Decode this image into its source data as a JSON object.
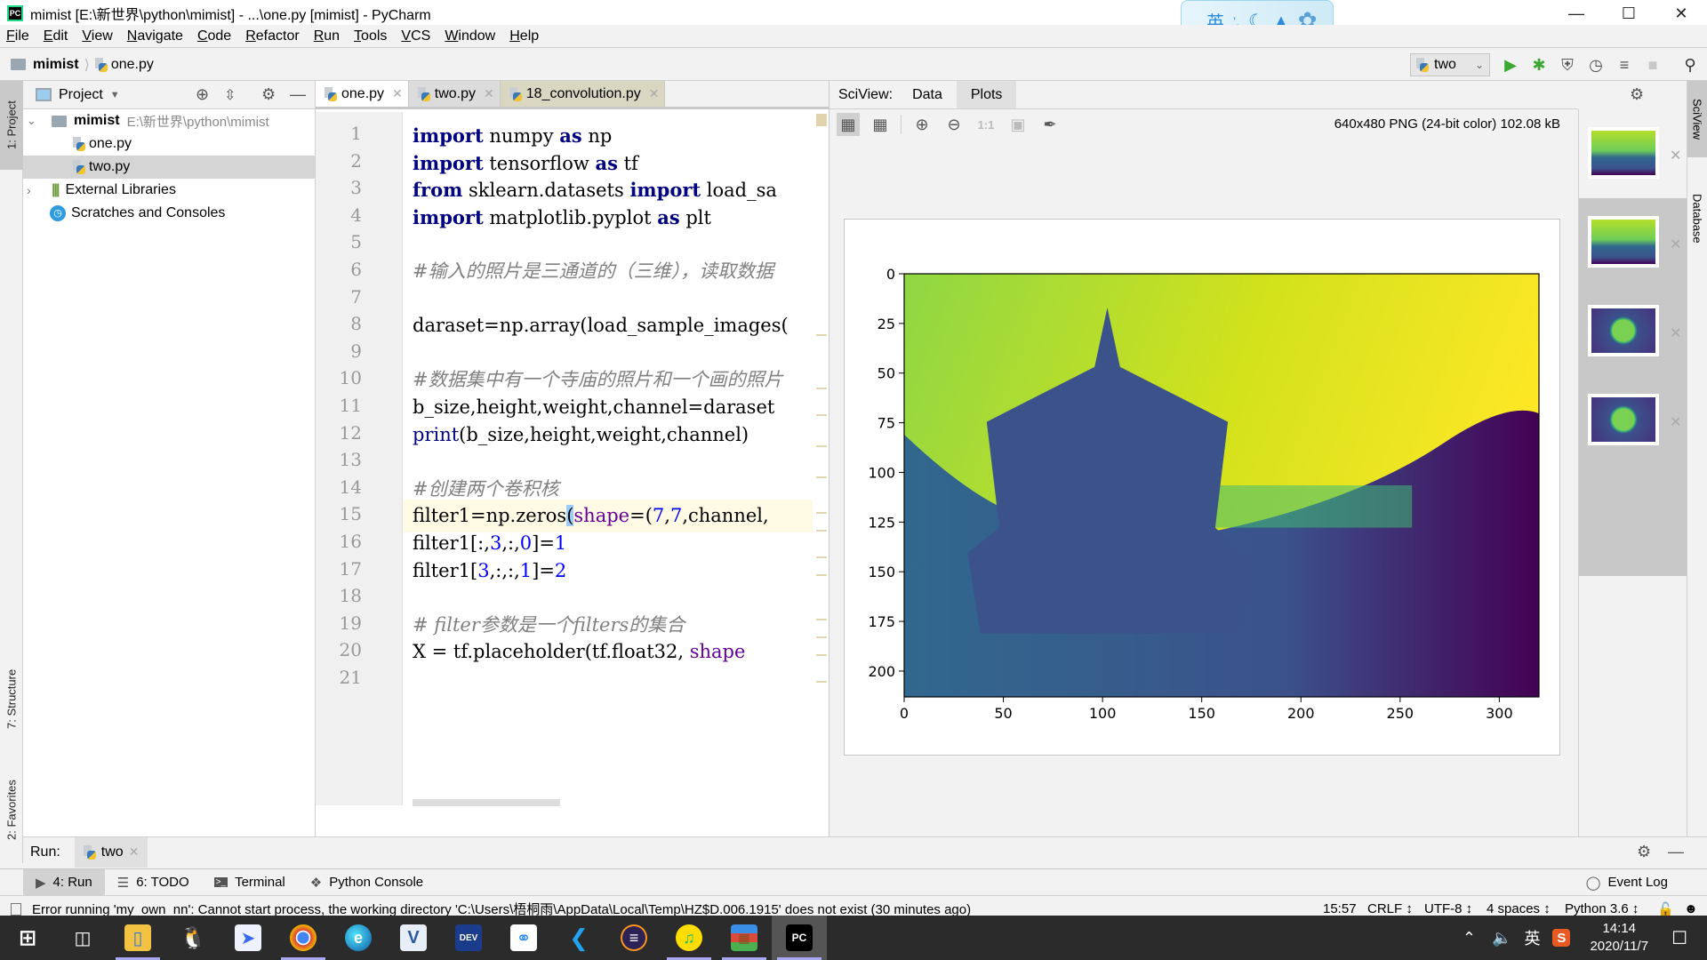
{
  "window": {
    "title": "mimist [E:\\新世界\\python\\mimist] - ...\\one.py [mimist] - PyCharm",
    "app_icon": "pycharm-icon",
    "controls": [
      "minimize",
      "maximize",
      "close"
    ]
  },
  "ime_bar": {
    "lang": "英",
    "icons": [
      "punctuation-icon",
      "moon-icon",
      "shirt-icon",
      "flower-icon"
    ]
  },
  "menu": [
    "File",
    "Edit",
    "View",
    "Navigate",
    "Code",
    "Refactor",
    "Run",
    "Tools",
    "VCS",
    "Window",
    "Help"
  ],
  "breadcrumb": {
    "project": "mimist",
    "file": "one.py"
  },
  "run_config": {
    "name": "two"
  },
  "toolbar_icons": [
    "run-icon",
    "debug-icon",
    "coverage-icon",
    "profile-icon",
    "concurrency-icon",
    "stop-icon",
    "search-icon"
  ],
  "left_stripe": {
    "project": "1: Project",
    "structure": "7: Structure",
    "favorites": "2: Favorites"
  },
  "project_panel": {
    "title": "Project",
    "tree": [
      {
        "label": "mimist",
        "path": "E:\\新世界\\python\\mimist",
        "level": 0,
        "type": "folder",
        "expanded": true
      },
      {
        "label": "one.py",
        "level": 1,
        "type": "py"
      },
      {
        "label": "two.py",
        "level": 1,
        "type": "py",
        "selected": true
      },
      {
        "label": "External Libraries",
        "level": 0,
        "type": "libs",
        "expanded": false
      },
      {
        "label": "Scratches and Consoles",
        "level": 0,
        "type": "scratch"
      }
    ]
  },
  "editor": {
    "tabs": [
      {
        "label": "one.py",
        "active": true
      },
      {
        "label": "two.py",
        "active": false
      },
      {
        "label": "18_convolution.py",
        "active": false
      }
    ],
    "current_line": 15,
    "lines": [
      {
        "n": "1",
        "text": "import numpy as np"
      },
      {
        "n": "2",
        "text": "import tensorflow as tf"
      },
      {
        "n": "3",
        "text": "from sklearn.datasets import load_sa"
      },
      {
        "n": "4",
        "text": "import matplotlib.pyplot as plt"
      },
      {
        "n": "5",
        "text": ""
      },
      {
        "n": "6",
        "text": "#输入的照片是三通道的（三维），读取数据"
      },
      {
        "n": "7",
        "text": ""
      },
      {
        "n": "8",
        "text": "daraset=np.array(load_sample_images("
      },
      {
        "n": "9",
        "text": ""
      },
      {
        "n": "10",
        "text": "#数据集中有一个寺庙的照片和一个画的照片"
      },
      {
        "n": "11",
        "text": "b_size,height,weight,channel=daraset"
      },
      {
        "n": "12",
        "text": "print(b_size,height,weight,channel)"
      },
      {
        "n": "13",
        "text": ""
      },
      {
        "n": "14",
        "text": "#创建两个卷积核"
      },
      {
        "n": "15",
        "text": "filter1=np.zeros(shape=(7,7,channel,"
      },
      {
        "n": "16",
        "text": "filter1[:,3,:,0]=1"
      },
      {
        "n": "17",
        "text": "filter1[3,:,:,1]=2"
      },
      {
        "n": "18",
        "text": ""
      },
      {
        "n": "19",
        "text": "# filter参数是一个filters的集合"
      },
      {
        "n": "20",
        "text": "X = tf.placeholder(tf.float32, shape"
      },
      {
        "n": "21",
        "text": ""
      }
    ]
  },
  "sciview": {
    "label": "SciView:",
    "tabs": [
      {
        "label": "Data",
        "active": false
      },
      {
        "label": "Plots",
        "active": true
      }
    ],
    "tools": [
      "chessboard-icon",
      "grid-icon",
      "zoom-in-icon",
      "zoom-out-icon",
      "actual-size-icon",
      "fit-icon",
      "color-picker-icon"
    ],
    "actual_size_label": "1:1",
    "image_info": "640x480 PNG (24-bit color) 102.08 kB",
    "thumbnails": [
      {
        "subject": "temple",
        "selected": true
      },
      {
        "subject": "temple",
        "selected": false
      },
      {
        "subject": "flower",
        "selected": false
      },
      {
        "subject": "flower",
        "selected": false
      }
    ]
  },
  "chart_data": {
    "type": "heatmap",
    "title": "",
    "description": "imshow of temple sample image (single channel, viridis colormap)",
    "colormap": "viridis",
    "x_ticks": [
      "0",
      "50",
      "100",
      "150",
      "200",
      "250",
      "300"
    ],
    "y_ticks": [
      "0",
      "25",
      "50",
      "75",
      "100",
      "125",
      "150",
      "175",
      "200"
    ],
    "xlim": [
      0,
      320
    ],
    "ylim": [
      213,
      0
    ]
  },
  "right_stripe": {
    "sciview": "SciView",
    "database": "Database"
  },
  "run_panel": {
    "label": "Run:",
    "tab": "two"
  },
  "bottom_tabs": [
    {
      "label": "4: Run",
      "icon": "run-icon",
      "active": true
    },
    {
      "label": "6: TODO",
      "icon": "list-icon",
      "active": false
    },
    {
      "label": "Terminal",
      "icon": "terminal-icon",
      "active": false
    },
    {
      "label": "Python Console",
      "icon": "python-console-icon",
      "active": false
    }
  ],
  "event_log": "Event Log",
  "status": {
    "message": "Error running 'my_own_nn': Cannot start process, the working directory 'C:\\Users\\梧桐雨\\AppData\\Local\\Temp\\HZ$D.006.1915' does not exist (30 minutes ago)",
    "position": "15:57",
    "line_sep": "CRLF",
    "encoding": "UTF-8",
    "indent": "4 spaces",
    "interpreter": "Python 3.6"
  },
  "taskbar": {
    "apps": [
      {
        "name": "start-icon",
        "running": false
      },
      {
        "name": "task-view-icon",
        "running": false
      },
      {
        "name": "file-explorer-icon",
        "running": true
      },
      {
        "name": "qq-icon",
        "running": false
      },
      {
        "name": "feishu-icon",
        "running": false
      },
      {
        "name": "chrome-icon",
        "running": true
      },
      {
        "name": "edge-icon",
        "running": false
      },
      {
        "name": "visual-studio-icon",
        "running": false
      },
      {
        "name": "devcpp-icon",
        "running": false
      },
      {
        "name": "baidu-netdisk-icon",
        "running": false
      },
      {
        "name": "vscode-icon",
        "running": false
      },
      {
        "name": "eclipse-icon",
        "running": false
      },
      {
        "name": "qq-music-icon",
        "running": true
      },
      {
        "name": "winrar-icon",
        "running": true
      },
      {
        "name": "pycharm-icon",
        "running": true,
        "active": true
      }
    ],
    "tray": {
      "ime": "英",
      "time": "14:14",
      "date": "2020/11/7"
    }
  }
}
